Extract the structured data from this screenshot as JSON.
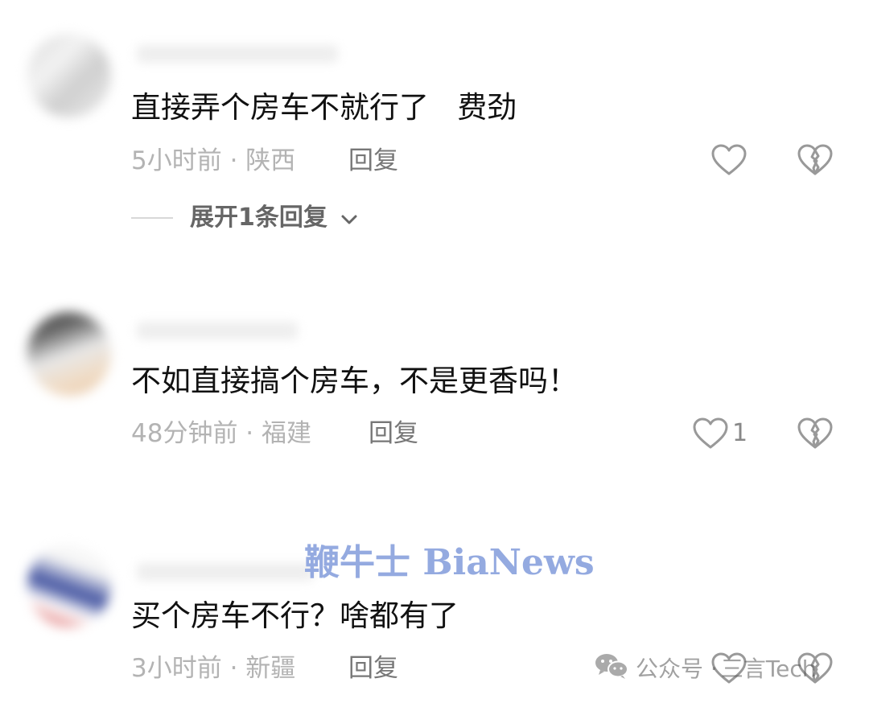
{
  "comments": [
    {
      "text": "直接弄个房车不就行了   费劲",
      "time_location": "5小时前 · 陕西",
      "reply_label": "回复",
      "likes": "",
      "expand_label": "展开1条回复"
    },
    {
      "text": "不如直接搞个房车，不是更香吗！",
      "time_location": "48分钟前 · 福建",
      "reply_label": "回复",
      "likes": "1"
    },
    {
      "text": "买个房车不行？啥都有了",
      "time_location": "3小时前 · 新疆",
      "reply_label": "回复",
      "likes": ""
    }
  ],
  "watermark": {
    "text": "鞭牛士 BiaNews"
  },
  "wechat_badge": {
    "label": "公众号 ·",
    "name": "三言Tech"
  },
  "icons": {
    "like": "heart-outline-icon",
    "dislike": "broken-heart-icon",
    "expand": "chevron-down-icon",
    "wechat": "wechat-logo-icon"
  },
  "colors": {
    "text": "#111111",
    "meta": "#b3b3b3",
    "reply": "#777777",
    "icon_stroke": "#999999",
    "watermark": "#8fa6df"
  }
}
